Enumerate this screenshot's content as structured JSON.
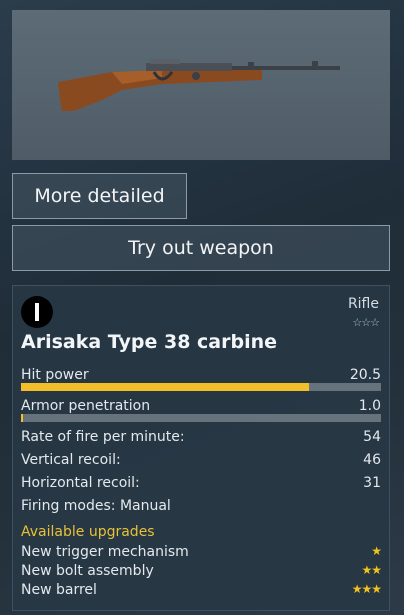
{
  "weapon": {
    "name": "Arisaka Type 38 carbine",
    "class": "Rifle",
    "tier_stars": "☆☆☆",
    "nation_icon": "nation-emblem-icon",
    "accent_color": "#f2be2a"
  },
  "buttons": {
    "more_detailed": "More detailed",
    "try_out": "Try out weapon"
  },
  "stats": {
    "hit_power": {
      "label": "Hit power",
      "value": "20.5",
      "fill_percent": 80
    },
    "armor_penetration": {
      "label": "Armor penetration",
      "value": "1.0",
      "fill_percent": 0.5
    },
    "rate_of_fire": {
      "label": "Rate of fire per minute:",
      "value": "54"
    },
    "vertical_recoil": {
      "label": "Vertical recoil:",
      "value": "46"
    },
    "horizontal_recoil": {
      "label": "Horizontal recoil:",
      "value": "31"
    },
    "firing_modes": {
      "label": "Firing modes: Manual"
    }
  },
  "upgrades": {
    "title": "Available upgrades",
    "items": [
      {
        "label": "New trigger mechanism",
        "stars": "★"
      },
      {
        "label": "New bolt assembly",
        "stars": "★★"
      },
      {
        "label": "New barrel",
        "stars": "★★★"
      }
    ]
  }
}
